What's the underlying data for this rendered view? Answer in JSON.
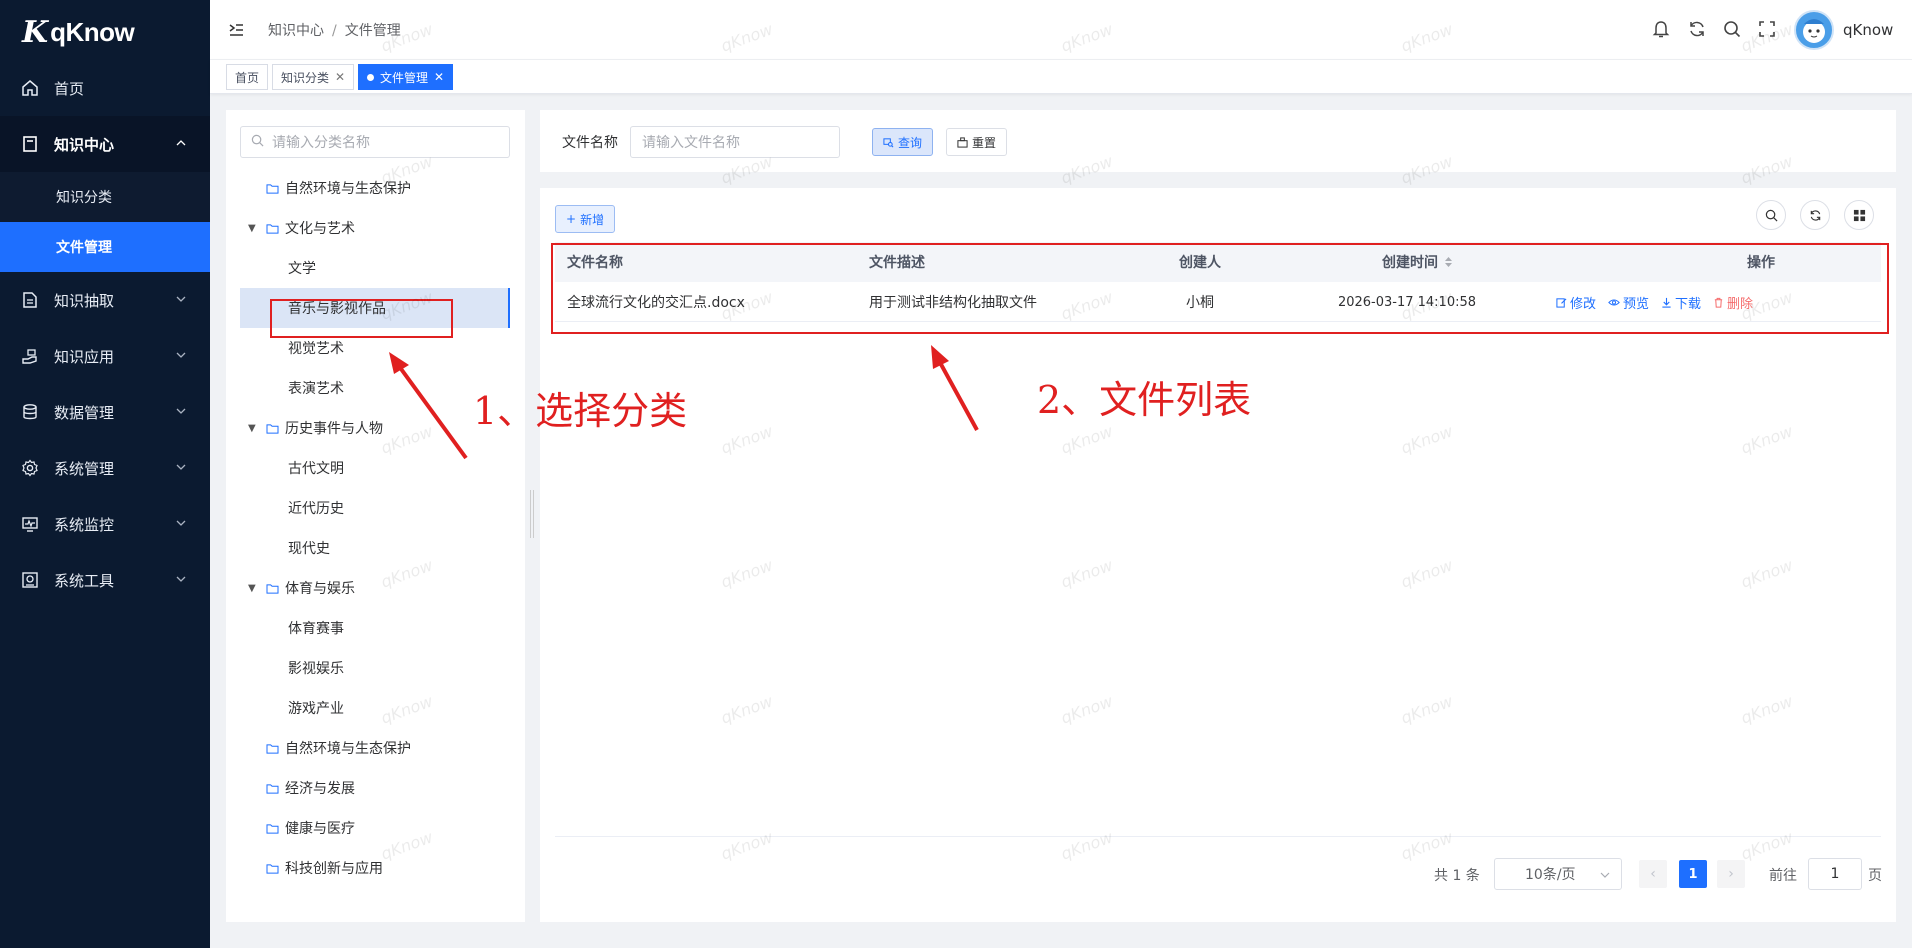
{
  "app": {
    "logo_mark": "K",
    "logo_text": "qKnow"
  },
  "sidebar": {
    "items": [
      {
        "label": "首页",
        "icon": "home-icon"
      },
      {
        "label": "知识中心",
        "icon": "book-icon",
        "expanded": true,
        "children": [
          {
            "label": "知识分类"
          },
          {
            "label": "文件管理",
            "active": true
          }
        ]
      },
      {
        "label": "知识抽取",
        "icon": "document-icon"
      },
      {
        "label": "知识应用",
        "icon": "hand-icon"
      },
      {
        "label": "数据管理",
        "icon": "database-icon"
      },
      {
        "label": "系统管理",
        "icon": "gear-icon"
      },
      {
        "label": "系统监控",
        "icon": "monitor-icon"
      },
      {
        "label": "系统工具",
        "icon": "tools-icon"
      }
    ]
  },
  "header": {
    "breadcrumb": [
      "知识中心",
      "文件管理"
    ],
    "breadcrumb_sep": "/",
    "username": "qKnow"
  },
  "tags": [
    {
      "label": "首页",
      "closable": false
    },
    {
      "label": "知识分类",
      "closable": true
    },
    {
      "label": "文件管理",
      "closable": true,
      "active": true
    }
  ],
  "tree": {
    "search_placeholder": "请输入分类名称",
    "nodes": [
      {
        "label": "自然环境与生态保护",
        "level": 0,
        "folder": true,
        "expandable": false
      },
      {
        "label": "文化与艺术",
        "level": 0,
        "folder": true,
        "expandable": true
      },
      {
        "label": "文学",
        "level": 1
      },
      {
        "label": "音乐与影视作品",
        "level": 1,
        "selected": true
      },
      {
        "label": "视觉艺术",
        "level": 1
      },
      {
        "label": "表演艺术",
        "level": 1
      },
      {
        "label": "历史事件与人物",
        "level": 0,
        "folder": true,
        "expandable": true
      },
      {
        "label": "古代文明",
        "level": 1
      },
      {
        "label": "近代历史",
        "level": 1
      },
      {
        "label": "现代史",
        "level": 1
      },
      {
        "label": "体育与娱乐",
        "level": 0,
        "folder": true,
        "expandable": true
      },
      {
        "label": "体育赛事",
        "level": 1
      },
      {
        "label": "影视娱乐",
        "level": 1
      },
      {
        "label": "游戏产业",
        "level": 1
      },
      {
        "label": "自然环境与生态保护",
        "level": 0,
        "folder": true,
        "expandable": false
      },
      {
        "label": "经济与发展",
        "level": 0,
        "folder": true,
        "expandable": false
      },
      {
        "label": "健康与医疗",
        "level": 0,
        "folder": true,
        "expandable": false
      },
      {
        "label": "科技创新与应用",
        "level": 0,
        "folder": true,
        "expandable": false
      }
    ]
  },
  "search_form": {
    "label": "文件名称",
    "placeholder": "请输入文件名称",
    "query_label": "查询",
    "reset_label": "重置"
  },
  "toolbar": {
    "add_label": "新增"
  },
  "table": {
    "columns": [
      "文件名称",
      "文件描述",
      "创建人",
      "创建时间",
      "操作"
    ],
    "rows": [
      {
        "name": "全球流行文化的交汇点.docx",
        "desc": "用于测试非结构化抽取文件",
        "creator": "小桐",
        "created": "2026-03-17 14:10:58"
      }
    ],
    "actions": {
      "edit": "修改",
      "preview": "预览",
      "download": "下载",
      "delete": "删除"
    }
  },
  "pagination": {
    "total_text": "共 1 条",
    "page_size": "10条/页",
    "current": "1",
    "goto_prefix": "前往",
    "goto_value": "1",
    "goto_suffix": "页"
  },
  "annotations": {
    "step1": "1、选择分类",
    "step2": "2、文件列表"
  },
  "watermark": "qKnow",
  "colors": {
    "sidebar_bg": "#0b1a30",
    "primary": "#1e6fff",
    "danger": "#f56c6c",
    "annotation": "#e02020"
  }
}
